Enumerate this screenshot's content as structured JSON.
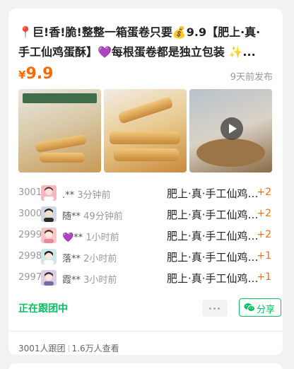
{
  "post": {
    "title": "📍巨!香!脆!整整一箱蛋卷只要💰9.9【肥上·真·手工仙鸡蛋酥】💜每根蛋卷都是独立包装 ✨...",
    "price_symbol": "¥",
    "price": "9.9",
    "post_time": "9天前发布"
  },
  "images": [
    {
      "name": "product-photo-1"
    },
    {
      "name": "product-photo-2"
    },
    {
      "name": "product-video-3",
      "has_play": true
    }
  ],
  "records": [
    {
      "seq": "3001",
      "user": ".**",
      "time": "3分钟前",
      "product": "肥上·真·手工仙鸡蛋酥",
      "qty": "+2",
      "avatar_color": "#f4b8c0"
    },
    {
      "seq": "3000",
      "user": "随**",
      "time": "49分钟前",
      "product": "肥上·真·手工仙鸡蛋酥",
      "qty": "+2",
      "avatar_color": "#cfd8e3"
    },
    {
      "seq": "2999",
      "user": "💜**",
      "time": "1小时前",
      "product": "肥上·真·手工仙鸡蛋酥",
      "qty": "+2",
      "avatar_color": "#f6c7c7"
    },
    {
      "seq": "2998",
      "user": "落**",
      "time": "2小时前",
      "product": "肥上·真·手工仙鸡蛋酥",
      "qty": "+1",
      "avatar_color": "#cfe8e6"
    },
    {
      "seq": "2997",
      "user": "霞**",
      "time": "3小时前",
      "product": "肥上·真·手工仙鸡蛋酥",
      "qty": "+1",
      "avatar_color": "#d9d0e8"
    }
  ],
  "actions": {
    "following_label": "正在跟团中",
    "share_label": "分享"
  },
  "stats": {
    "joined": "3001人跟团",
    "views": "1.6万人查看"
  },
  "colors": {
    "accent": "#ff6a00",
    "wechat_green": "#07c160"
  }
}
